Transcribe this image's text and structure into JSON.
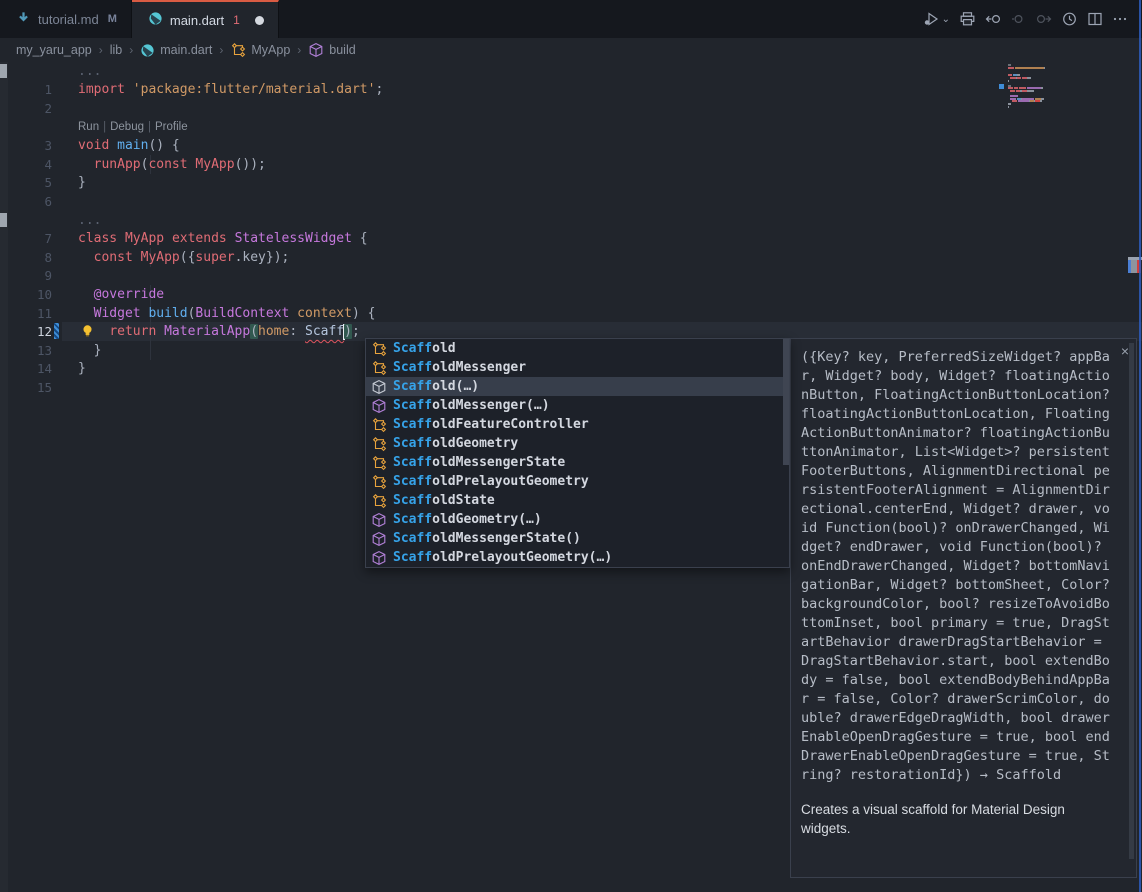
{
  "colors": {
    "accent_tab": "#d95b43",
    "keyword": "#e06c75",
    "call": "#e06c75",
    "type": "#c678dd",
    "string": "#d19a66",
    "param": "#d19a66",
    "plain": "#abb2bf",
    "fold": "#5a6170",
    "function": "#61afef",
    "match_blue": "#36a3e9",
    "class_icon": "#e8a33d",
    "constructor_icon": "#b180d7",
    "dart_teal": "#55c6d4",
    "markdown_blue": "#519aba",
    "error_red": "#e0555f"
  },
  "tab_bar": {
    "tabs": [
      {
        "label": "tutorial.md",
        "badge": "M",
        "icon": "markdown",
        "active": false,
        "dirty": false
      },
      {
        "label": "main.dart",
        "badge": "1",
        "icon": "dart",
        "active": true,
        "dirty": true
      }
    ],
    "actions": [
      {
        "name": "run-or-debug",
        "icon": "run-debug",
        "chevron": true,
        "disabled": false
      },
      {
        "name": "print",
        "icon": "print",
        "chevron": false,
        "disabled": false
      },
      {
        "name": "navigate-back",
        "icon": "nav-back",
        "chevron": false,
        "disabled": false
      },
      {
        "name": "navigate",
        "icon": "nav-circle",
        "chevron": false,
        "disabled": true
      },
      {
        "name": "navigate-forward",
        "icon": "nav-forward",
        "chevron": false,
        "disabled": true
      },
      {
        "name": "timeline",
        "icon": "history",
        "chevron": false,
        "disabled": false
      },
      {
        "name": "split-editor",
        "icon": "split",
        "chevron": false,
        "disabled": false
      },
      {
        "name": "more-actions",
        "icon": "more",
        "chevron": false,
        "disabled": false
      }
    ]
  },
  "breadcrumb": {
    "separator": "›",
    "items": [
      {
        "label": "my_yaru_app",
        "icon": null
      },
      {
        "label": "lib",
        "icon": null
      },
      {
        "label": "main.dart",
        "icon": "dart"
      },
      {
        "label": "MyApp",
        "icon": "class"
      },
      {
        "label": "build",
        "icon": "cube"
      }
    ]
  },
  "editor": {
    "codelens": {
      "items": [
        "Run",
        "Debug",
        "Profile"
      ],
      "separator": "|"
    },
    "rows": [
      {
        "n": null,
        "kind": "fold",
        "chip": true,
        "tokens": [
          [
            "...",
            "fold"
          ]
        ]
      },
      {
        "n": "1",
        "kind": "code",
        "tokens": [
          [
            "import",
            "kw"
          ],
          [
            " ",
            "pl"
          ],
          [
            "'package:flutter/material.dart'",
            "str"
          ],
          [
            ";",
            "pl"
          ]
        ]
      },
      {
        "n": "2",
        "kind": "code",
        "tokens": []
      },
      {
        "n": null,
        "kind": "codelens",
        "tokens": []
      },
      {
        "n": "3",
        "kind": "code",
        "tokens": [
          [
            "void",
            "kw"
          ],
          [
            " ",
            "pl"
          ],
          [
            "main",
            "fn"
          ],
          [
            "() {",
            "pl"
          ]
        ]
      },
      {
        "n": "4",
        "kind": "code",
        "guide": true,
        "tokens": [
          [
            "  ",
            "pl"
          ],
          [
            "runApp",
            "call"
          ],
          [
            "(",
            "pl"
          ],
          [
            "const",
            "kw"
          ],
          [
            " ",
            "pl"
          ],
          [
            "MyApp",
            "call"
          ],
          [
            "());",
            "pl"
          ]
        ]
      },
      {
        "n": "5",
        "kind": "code",
        "tokens": [
          [
            "}",
            "pl"
          ]
        ]
      },
      {
        "n": "6",
        "kind": "code",
        "tokens": []
      },
      {
        "n": null,
        "kind": "fold",
        "chip": true,
        "tokens": [
          [
            "...",
            "fold"
          ]
        ]
      },
      {
        "n": "7",
        "kind": "code",
        "tokens": [
          [
            "class",
            "kw"
          ],
          [
            " ",
            "pl"
          ],
          [
            "MyApp",
            "call"
          ],
          [
            " ",
            "pl"
          ],
          [
            "extends",
            "kw"
          ],
          [
            " ",
            "pl"
          ],
          [
            "StatelessWidget",
            "type"
          ],
          [
            " {",
            "pl"
          ]
        ]
      },
      {
        "n": "8",
        "kind": "code",
        "guide": true,
        "tokens": [
          [
            "  ",
            "pl"
          ],
          [
            "const",
            "kw"
          ],
          [
            " ",
            "pl"
          ],
          [
            "MyApp",
            "call"
          ],
          [
            "({",
            "pl"
          ],
          [
            "super",
            "kw"
          ],
          [
            ".key});",
            "pl"
          ]
        ]
      },
      {
        "n": "9",
        "kind": "code",
        "tokens": []
      },
      {
        "n": "10",
        "kind": "code",
        "guide": true,
        "tokens": [
          [
            "  ",
            "pl"
          ],
          [
            "@override",
            "type"
          ]
        ]
      },
      {
        "n": "11",
        "kind": "code",
        "guide": true,
        "tokens": [
          [
            "  ",
            "pl"
          ],
          [
            "Widget",
            "type"
          ],
          [
            " ",
            "pl"
          ],
          [
            "build",
            "fn"
          ],
          [
            "(",
            "pl"
          ],
          [
            "BuildContext",
            "type"
          ],
          [
            " ",
            "pl"
          ],
          [
            "context",
            "arg"
          ],
          [
            ") {",
            "pl"
          ]
        ]
      },
      {
        "n": "12",
        "kind": "code",
        "current": true,
        "bulb": true,
        "guide": true,
        "tokens": [
          [
            "    ",
            "pl"
          ],
          [
            "return",
            "kw"
          ],
          [
            " ",
            "pl"
          ],
          [
            "MaterialApp",
            "type"
          ],
          [
            "(",
            "bracket"
          ],
          [
            "home",
            "arg"
          ],
          [
            ": ",
            "pl"
          ],
          [
            "Scaff",
            "err"
          ],
          [
            "",
            "cursor"
          ],
          [
            ")",
            "bracket"
          ],
          [
            ";",
            "pl"
          ]
        ]
      },
      {
        "n": "13",
        "kind": "code",
        "guide": true,
        "tokens": [
          [
            "  }",
            "pl"
          ]
        ]
      },
      {
        "n": "14",
        "kind": "code",
        "tokens": [
          [
            "}",
            "pl"
          ]
        ]
      },
      {
        "n": "15",
        "kind": "code",
        "tokens": []
      }
    ]
  },
  "popup": {
    "prefix": "Scaff",
    "selected_index": 2,
    "items": [
      {
        "rest": "old",
        "kind": "class"
      },
      {
        "rest": "oldMessenger",
        "kind": "class"
      },
      {
        "rest": "old(…)",
        "kind": "constructor"
      },
      {
        "rest": "oldMessenger(…)",
        "kind": "constructor"
      },
      {
        "rest": "oldFeatureController",
        "kind": "class"
      },
      {
        "rest": "oldGeometry",
        "kind": "class"
      },
      {
        "rest": "oldMessengerState",
        "kind": "class"
      },
      {
        "rest": "oldPrelayoutGeometry",
        "kind": "class"
      },
      {
        "rest": "oldState",
        "kind": "class"
      },
      {
        "rest": "oldGeometry(…)",
        "kind": "constructor"
      },
      {
        "rest": "oldMessengerState()",
        "kind": "constructor"
      },
      {
        "rest": "oldPrelayoutGeometry(…)",
        "kind": "constructor"
      }
    ]
  },
  "docs": {
    "signature": "({Key? key, PreferredSizeWidget? appBar, Widget? body, Widget? floatingActionButton, FloatingActionButtonLocation? floatingActionButtonLocation, FloatingActionButtonAnimator? floatingActionButtonAnimator, List<Widget>? persistentFooterButtons, AlignmentDirectional persistentFooterAlignment = AlignmentDirectional.centerEnd, Widget? drawer, void Function(bool)? onDrawerChanged, Widget? endDrawer, void Function(bool)? onEndDrawerChanged, Widget? bottomNavigationBar, Widget? bottomSheet, Color? backgroundColor, bool? resizeToAvoidBottomInset, bool primary = true, DragStartBehavior drawerDragStartBehavior = DragStartBehavior.start, bool extendBody = false, bool extendBodyBehindAppBar = false, Color? drawerScrimColor, double? drawerEdgeDragWidth, bool drawerEnableOpenDragGesture = true, bool endDrawerEnableOpenDragGesture = true, String? restorationId}) → Scaffold",
    "description": "Creates a visual scaffold for Material Design widgets.",
    "close_label": "×"
  }
}
